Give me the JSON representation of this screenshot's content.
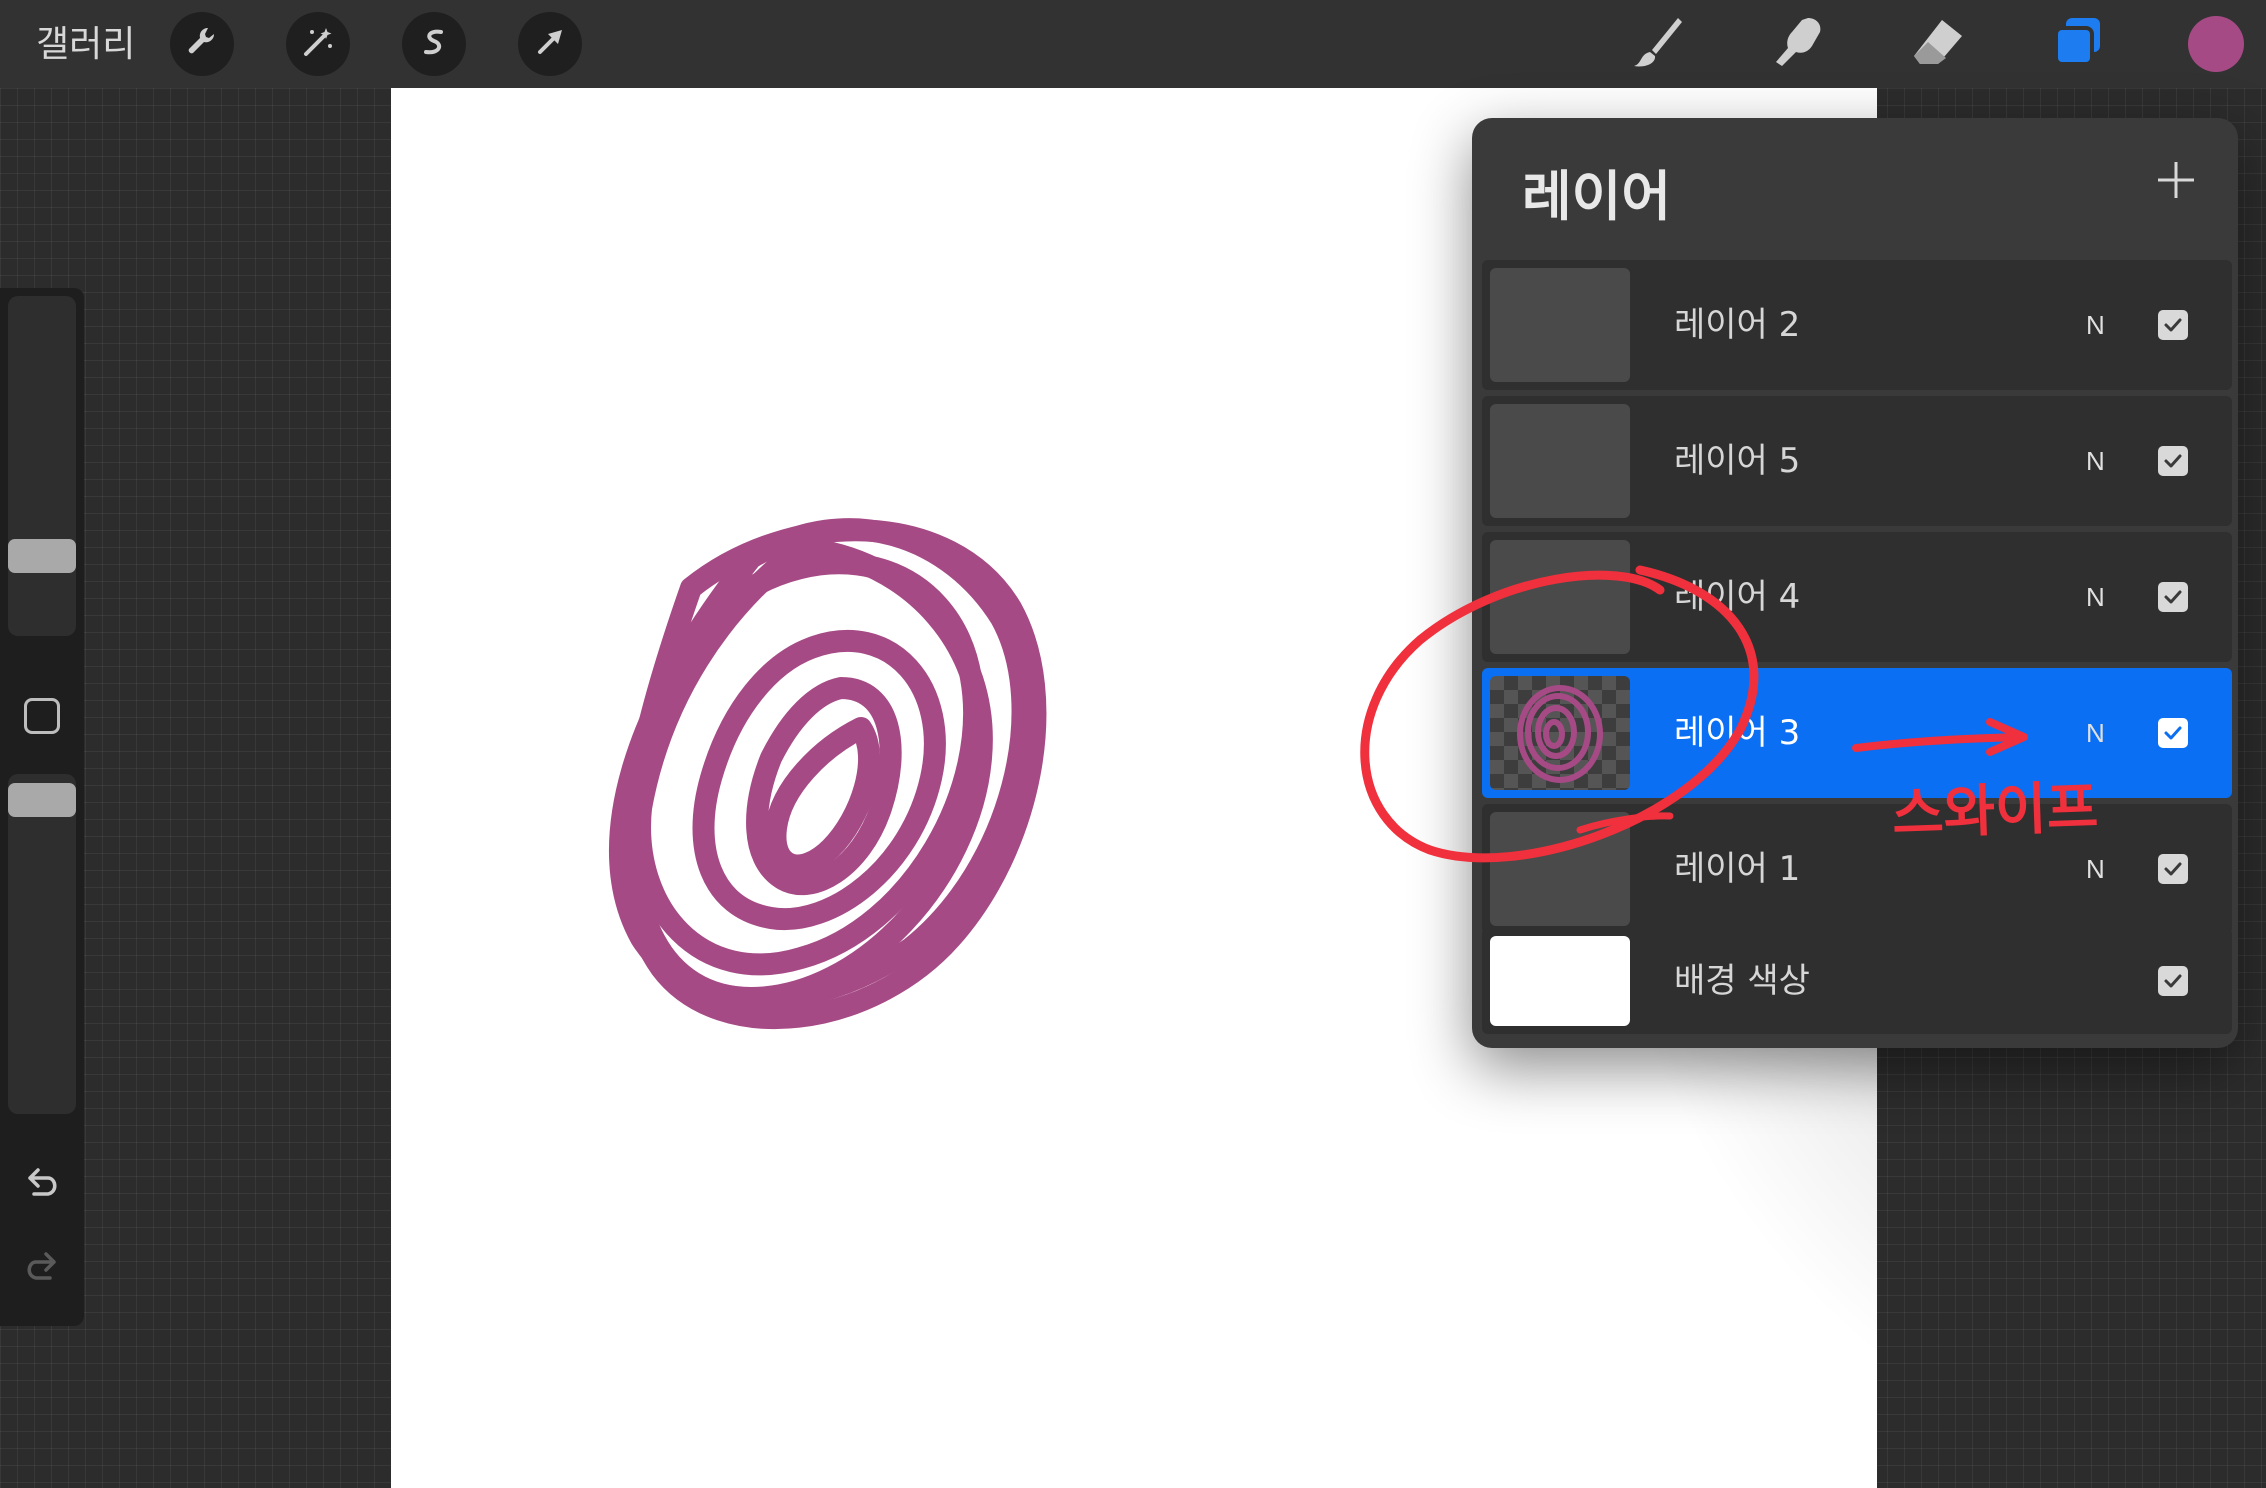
{
  "toolbar": {
    "gallery_label": "갤러리",
    "left_tools": [
      {
        "name": "actions",
        "icon": "wrench-icon"
      },
      {
        "name": "adjustments",
        "icon": "magic-wand-icon"
      },
      {
        "name": "selection",
        "icon": "selection-s-icon"
      },
      {
        "name": "transform",
        "icon": "arrow-cursor-icon"
      }
    ],
    "right_tools": [
      {
        "name": "paint",
        "icon": "brush-icon"
      },
      {
        "name": "smudge",
        "icon": "smudge-hand-icon"
      },
      {
        "name": "erase",
        "icon": "eraser-icon"
      },
      {
        "name": "layers",
        "icon": "layers-icon",
        "active": true
      }
    ],
    "current_color": "#a64a86",
    "active_tool_color": "#1c7cf0"
  },
  "sidebar": {
    "brush_size_level": 0.2,
    "opacity_level": 0.9,
    "modify_button_icon": "square-icon",
    "undo_icon": "undo-icon",
    "redo_icon": "redo-icon"
  },
  "canvas": {
    "background": "#ffffff",
    "stroke_color": "#a64a86"
  },
  "layers_panel": {
    "title": "레이어",
    "add_icon": "plus-icon",
    "layers": [
      {
        "name": "레이어 2",
        "blend": "N",
        "visible": true,
        "selected": false,
        "thumb": "empty"
      },
      {
        "name": "레이어 5",
        "blend": "N",
        "visible": true,
        "selected": false,
        "thumb": "empty"
      },
      {
        "name": "레이어 4",
        "blend": "N",
        "visible": true,
        "selected": false,
        "thumb": "empty"
      },
      {
        "name": "레이어 3",
        "blend": "N",
        "visible": true,
        "selected": true,
        "thumb": "scribble"
      },
      {
        "name": "레이어 1",
        "blend": "N",
        "visible": true,
        "selected": false,
        "thumb": "empty"
      },
      {
        "name": "배경 색상",
        "blend": "",
        "visible": true,
        "selected": false,
        "thumb": "white"
      }
    ],
    "selected_color": "#0a6ff2"
  },
  "annotation": {
    "text": "스와이프",
    "color": "#f0303c"
  }
}
